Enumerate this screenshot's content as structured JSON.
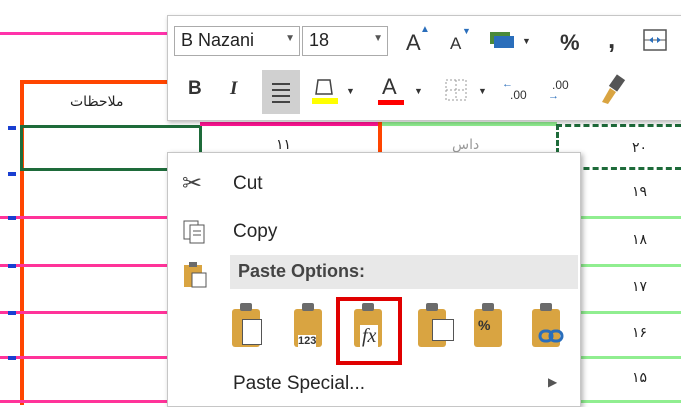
{
  "spreadsheet": {
    "header_notes": "ملاحظات",
    "row_numbers": [
      "٢٠",
      "١٩",
      "١٨",
      "١٧",
      "١۶",
      "١۵"
    ],
    "partial_cells": [
      "١١",
      "داس"
    ],
    "colors": {
      "pink": "#ff33aa",
      "red_orange": "#ff4500",
      "green": "#1e6b3a",
      "light_green": "#90ee90",
      "blue": "#1a3fd1"
    }
  },
  "mini_toolbar": {
    "font_name": "B Nazani",
    "font_size": "18",
    "increase_font_label": "A",
    "decrease_font_label": "A",
    "percent_label": "%",
    "comma_label": ",",
    "bold_label": "B",
    "italic_label": "I",
    "font_color_label": "A",
    "decimal_increase": ".00",
    "decimal_decrease": ".00",
    "fill_color": "#ffff00",
    "font_color": "#ff0000"
  },
  "context_menu": {
    "cut": "Cut",
    "copy": "Copy",
    "paste_options_header": "Paste Options:",
    "paste_special": "Paste Special...",
    "paste_values_badge": "123",
    "paste_formulas_badge": "fx",
    "highlight_color": "#e00000"
  }
}
